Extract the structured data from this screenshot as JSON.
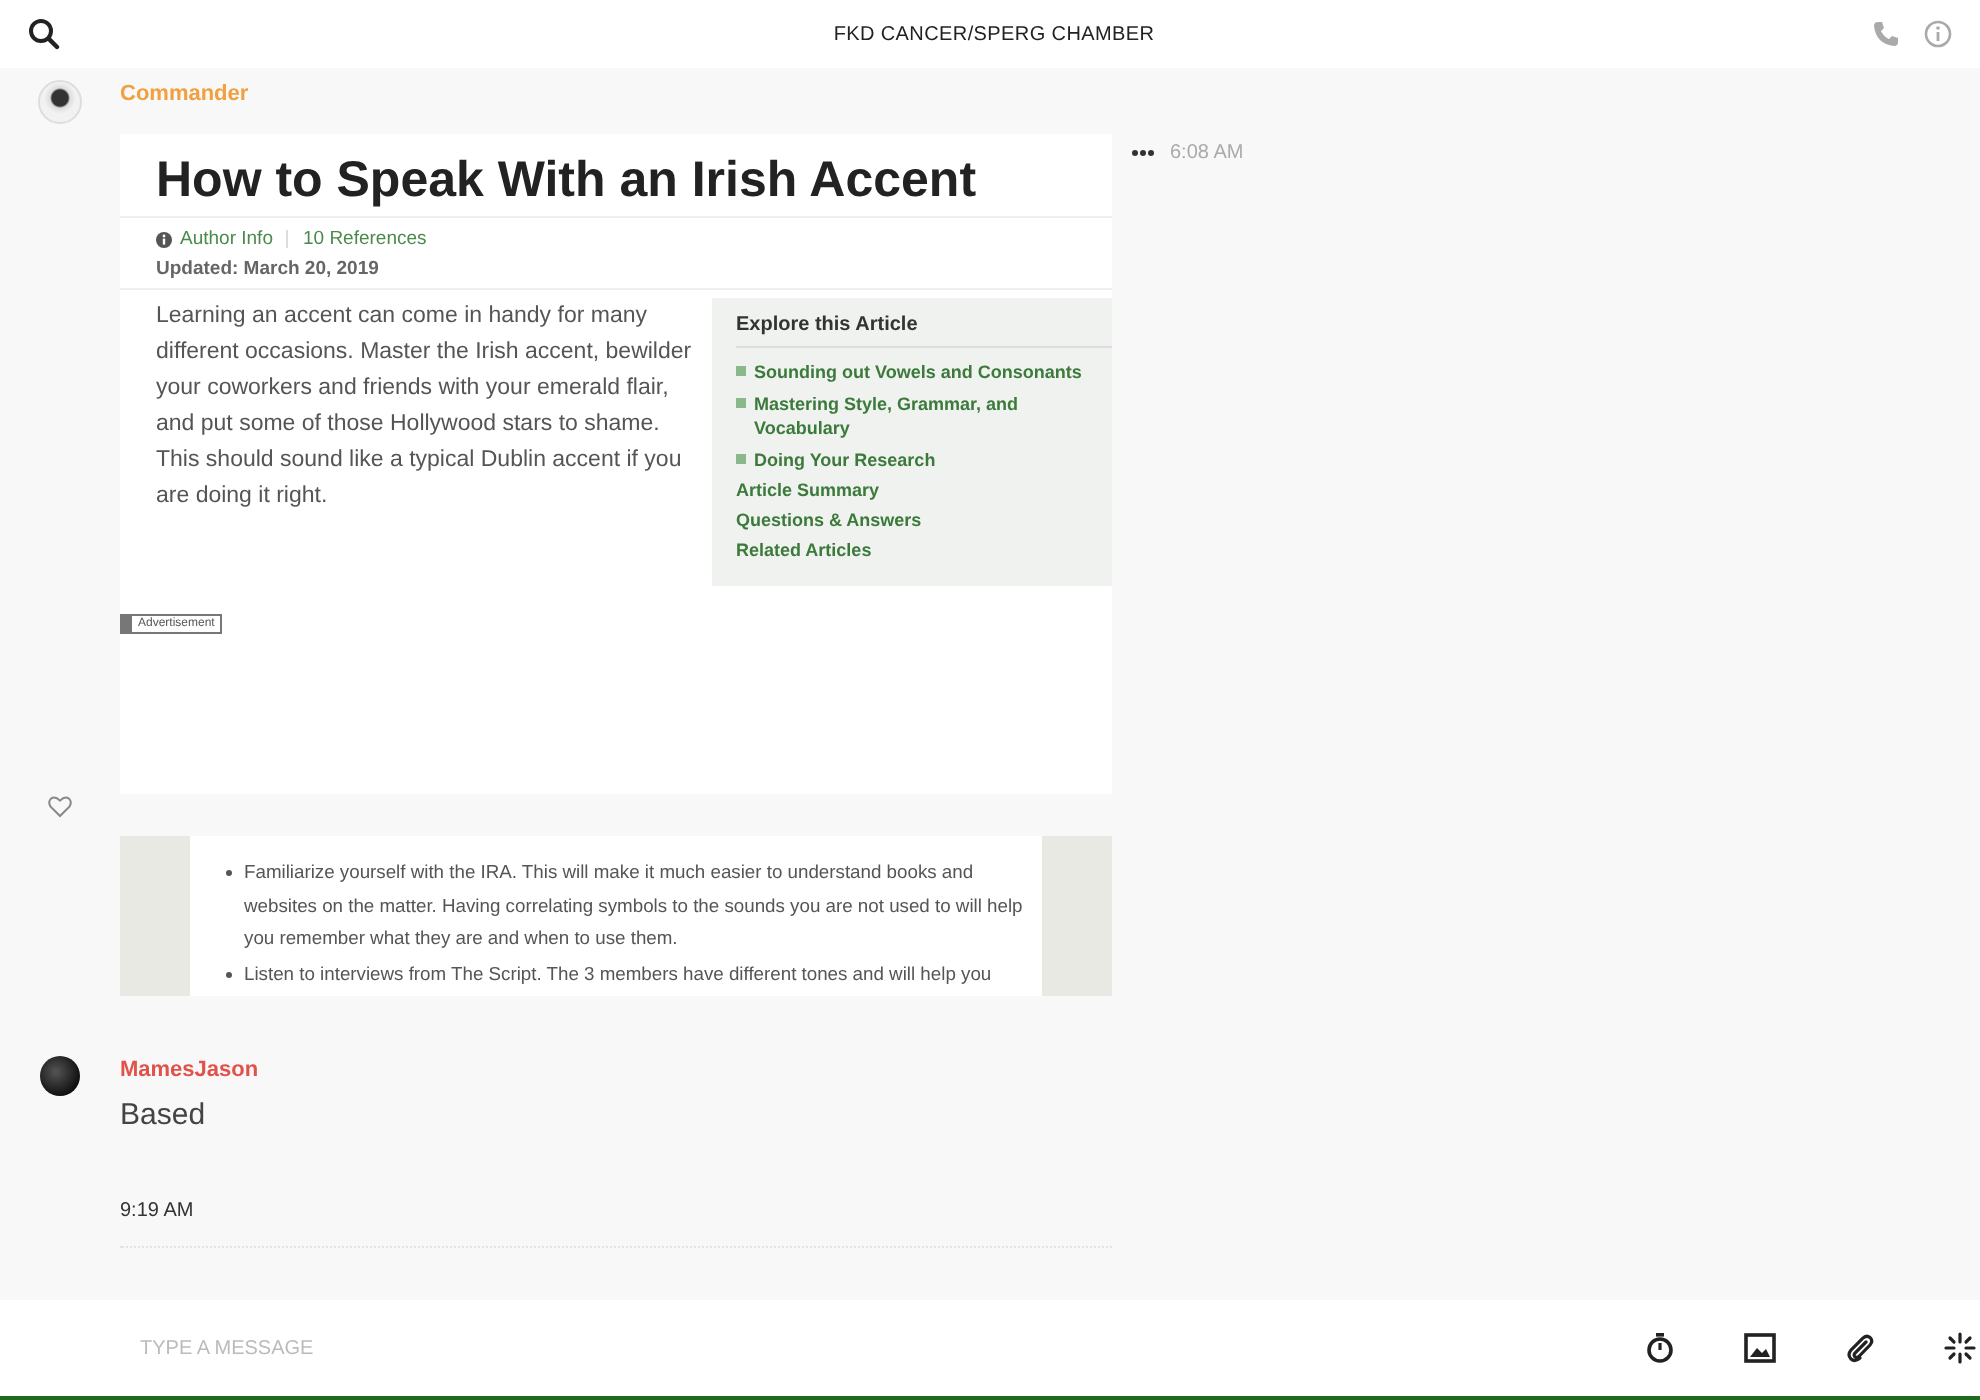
{
  "header": {
    "title": "FKD CANCER/SPERG CHAMBER"
  },
  "messages": [
    {
      "author": "Commander",
      "color": "#f0a040",
      "avatar": {
        "kind": "emblem"
      },
      "time": "6:08 AM",
      "liked": false,
      "article": {
        "title": "How to Speak With an Irish Accent",
        "author_info": "Author Info",
        "references": "10 References",
        "updated": "Updated: March 20, 2019",
        "intro": "Learning an accent can come in handy for many different occasions. Master the Irish accent, bewilder your coworkers and friends with your emerald flair, and put some of those Hollywood stars to shame. This should sound like a typical Dublin accent if you are doing it right.",
        "explore_title": "Explore this Article",
        "explore_items": [
          {
            "label": "Sounding out Vowels and Consonants",
            "kind": "section"
          },
          {
            "label": "Mastering Style, Grammar, and Vocabulary",
            "kind": "section"
          },
          {
            "label": "Doing Your Research",
            "kind": "section"
          },
          {
            "label": "Article Summary",
            "kind": "link"
          },
          {
            "label": "Questions & Answers",
            "kind": "link"
          },
          {
            "label": "Related Articles",
            "kind": "link"
          }
        ],
        "ad_label": "Advertisement"
      },
      "excerpt": {
        "bullets": [
          "Familiarize yourself with the IRA. This will make it much easier to understand books and websites on the matter. Having correlating symbols to the sounds you are not used to will help you remember what they are and when to use them.",
          "Listen to interviews from The Script. The 3 members have different tones and will help you"
        ]
      }
    },
    {
      "author": "MamesJason",
      "color": "#e0524a",
      "avatar": {
        "kind": "dark"
      },
      "text": "Based",
      "time": "9:19 AM"
    }
  ],
  "composer": {
    "placeholder": "TYPE A MESSAGE"
  }
}
